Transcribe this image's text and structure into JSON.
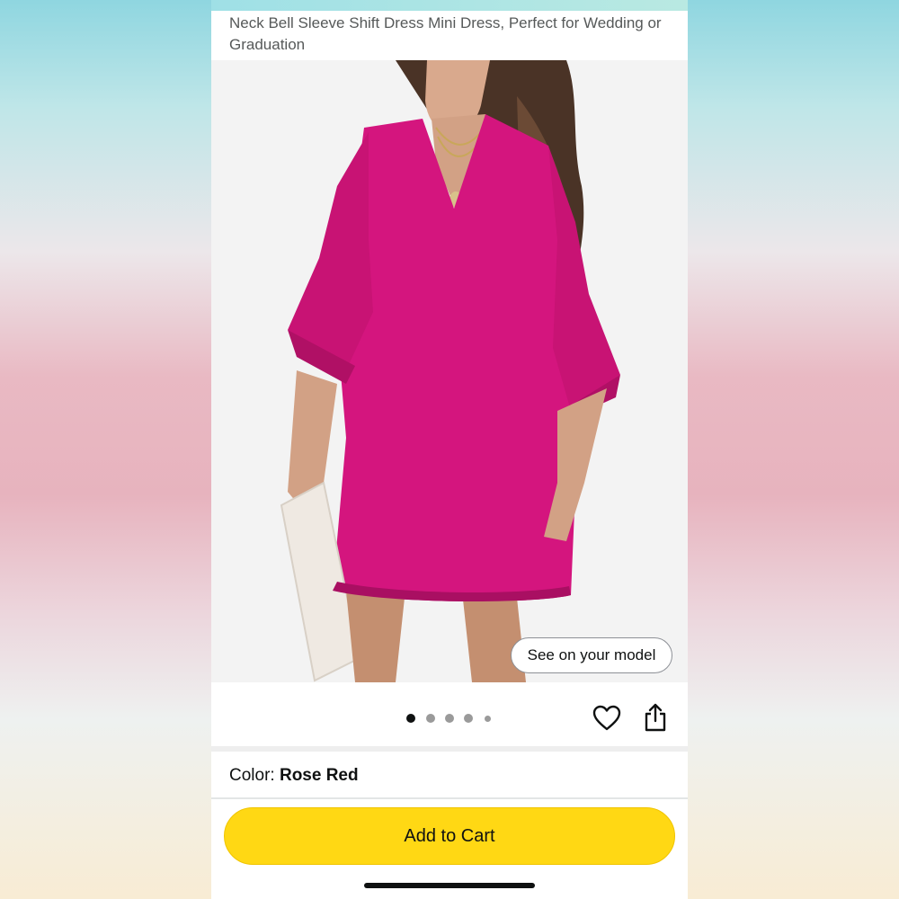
{
  "product": {
    "title": "Neck Bell Sleeve Shift Dress Mini Dress, Perfect for Wedding or Graduation",
    "image": {
      "description_icon": "product-photo",
      "see_on_model_label": "See on your model"
    },
    "carousel": {
      "total_dots": 5,
      "active_index": 0
    },
    "actions": {
      "wishlist_icon": "heart-icon",
      "share_icon": "share-icon"
    },
    "color": {
      "label": "Color:",
      "value": "Rose Red"
    }
  },
  "buy_box": {
    "add_to_cart_label": "Add to Cart"
  },
  "theme": {
    "cart_button_color": "#ffd814",
    "dress_color": "#d4157e"
  }
}
